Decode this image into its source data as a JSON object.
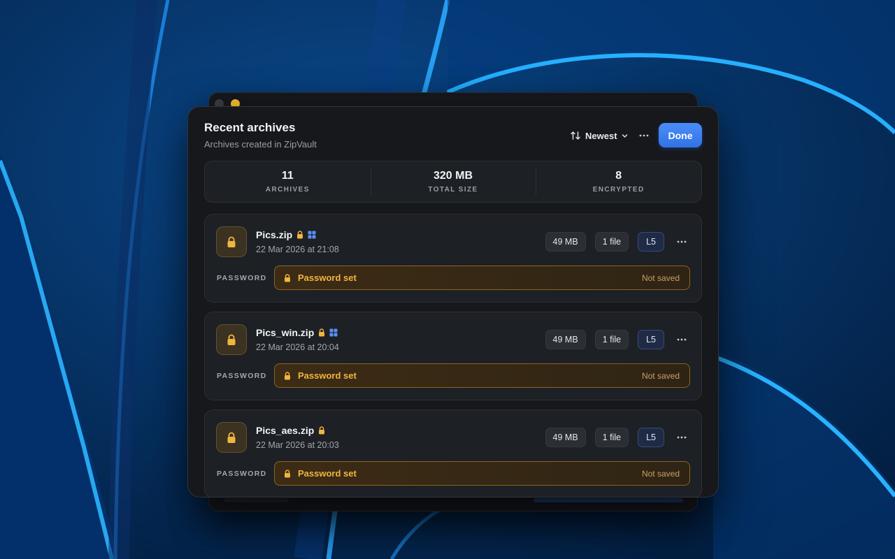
{
  "sheet": {
    "title": "Recent archives",
    "subtitle": "Archives created in ZipVault",
    "sort_label": "Newest",
    "done_label": "Done"
  },
  "stats": [
    {
      "value": "11",
      "label": "ARCHIVES"
    },
    {
      "value": "320 MB",
      "label": "TOTAL SIZE"
    },
    {
      "value": "8",
      "label": "ENCRYPTED"
    }
  ],
  "archives": [
    {
      "name": "Pics.zip",
      "date": "22 Mar 2026 at 21:08",
      "size": "49 MB",
      "files": "1 file",
      "level": "L5",
      "windows_compatible": true,
      "password_label": "PASSWORD",
      "password_status": "Password set",
      "password_note": "Not saved"
    },
    {
      "name": "Pics_win.zip",
      "date": "22 Mar 2026 at 20:04",
      "size": "49 MB",
      "files": "1 file",
      "level": "L5",
      "windows_compatible": true,
      "password_label": "PASSWORD",
      "password_status": "Password set",
      "password_note": "Not saved"
    },
    {
      "name": "Pics_aes.zip",
      "date": "22 Mar 2026 at 20:03",
      "size": "49 MB",
      "files": "1 file",
      "level": "L5",
      "windows_compatible": false,
      "password_label": "PASSWORD",
      "password_status": "Password set",
      "password_note": "Not saved"
    }
  ],
  "icons": {
    "sort": "sort-arrows-icon",
    "chevron": "chevron-down-icon",
    "more": "ellipsis-icon",
    "lock": "lock-icon",
    "windows": "windows-icon"
  },
  "colors": {
    "accent": "#3b7ff0",
    "lock": "#f0b53f",
    "windows": "#5b8ff2",
    "sheet_bg": "#16181c",
    "card_bg": "#1d2025"
  }
}
